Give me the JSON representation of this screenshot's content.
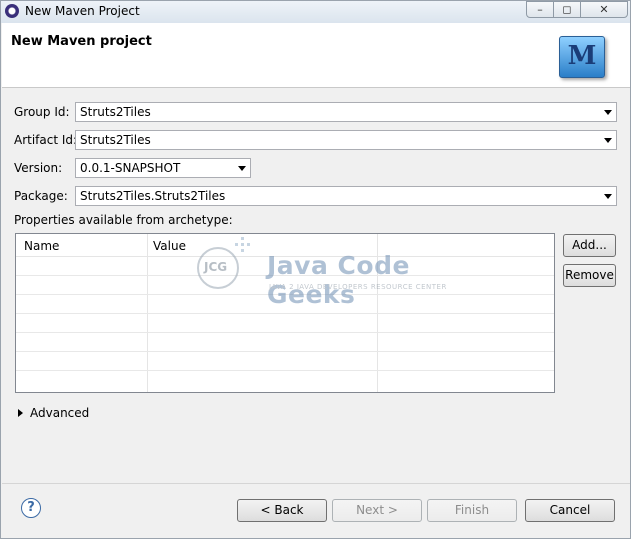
{
  "window": {
    "title": "New Maven Project",
    "minimize_glyph": "–",
    "maximize_glyph": "◻",
    "close_glyph": "✕"
  },
  "header": {
    "title": "New Maven project",
    "logo_letter": "M"
  },
  "form": {
    "group_id": {
      "label": "Group Id:",
      "value": "Struts2Tiles"
    },
    "artifact_id": {
      "label": "Artifact Id:",
      "value": "Struts2Tiles"
    },
    "version": {
      "label": "Version:",
      "value": "0.0.1-SNAPSHOT"
    },
    "package": {
      "label": "Package:",
      "value": "Struts2Tiles.Struts2Tiles"
    }
  },
  "properties": {
    "label": "Properties available from archetype:",
    "columns": [
      "Name",
      "Value"
    ],
    "add_label": "Add...",
    "remove_label": "Remove"
  },
  "watermark": {
    "logo_text": "JCG",
    "name": "Java Code Geeks",
    "tagline": "JAVA 2 JAVA DEVELOPERS RESOURCE CENTER"
  },
  "advanced": {
    "label": "Advanced"
  },
  "footer": {
    "help_glyph": "?",
    "back_label": "< Back",
    "next_label": "Next >",
    "finish_label": "Finish",
    "cancel_label": "Cancel"
  }
}
